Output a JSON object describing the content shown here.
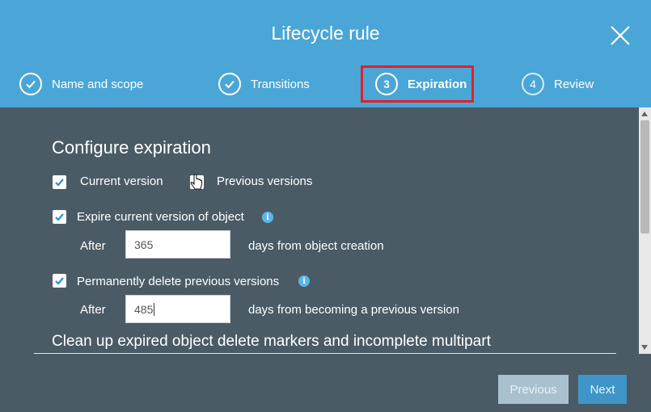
{
  "dialog": {
    "title": "Lifecycle rule",
    "close_icon": "close-icon"
  },
  "steps": [
    {
      "label": "Name and scope",
      "state": "done",
      "icon": "check-icon"
    },
    {
      "label": "Transitions",
      "state": "done",
      "icon": "check-icon"
    },
    {
      "number": "3",
      "label": "Expiration",
      "state": "active"
    },
    {
      "number": "4",
      "label": "Review",
      "state": "pending"
    }
  ],
  "section": {
    "heading": "Configure expiration",
    "current_version_label": "Current version",
    "previous_versions_label": "Previous versions",
    "expire_current_label": "Expire current version of object",
    "expire_current_after_label": "After",
    "expire_current_days": "365",
    "expire_current_suffix": "days from object creation",
    "delete_previous_label": "Permanently delete previous versions",
    "delete_previous_after_label": "After",
    "delete_previous_days": "485",
    "delete_previous_suffix": "days from becoming a previous version",
    "cleanup_heading": "Clean up expired object delete markers and incomplete multipart"
  },
  "footer": {
    "previous_label": "Previous",
    "next_label": "Next"
  },
  "colors": {
    "header_bg": "#4aa6d6",
    "body_bg": "#4a5b66",
    "highlight_border": "#e0202a",
    "next_button": "#3f95c7"
  }
}
